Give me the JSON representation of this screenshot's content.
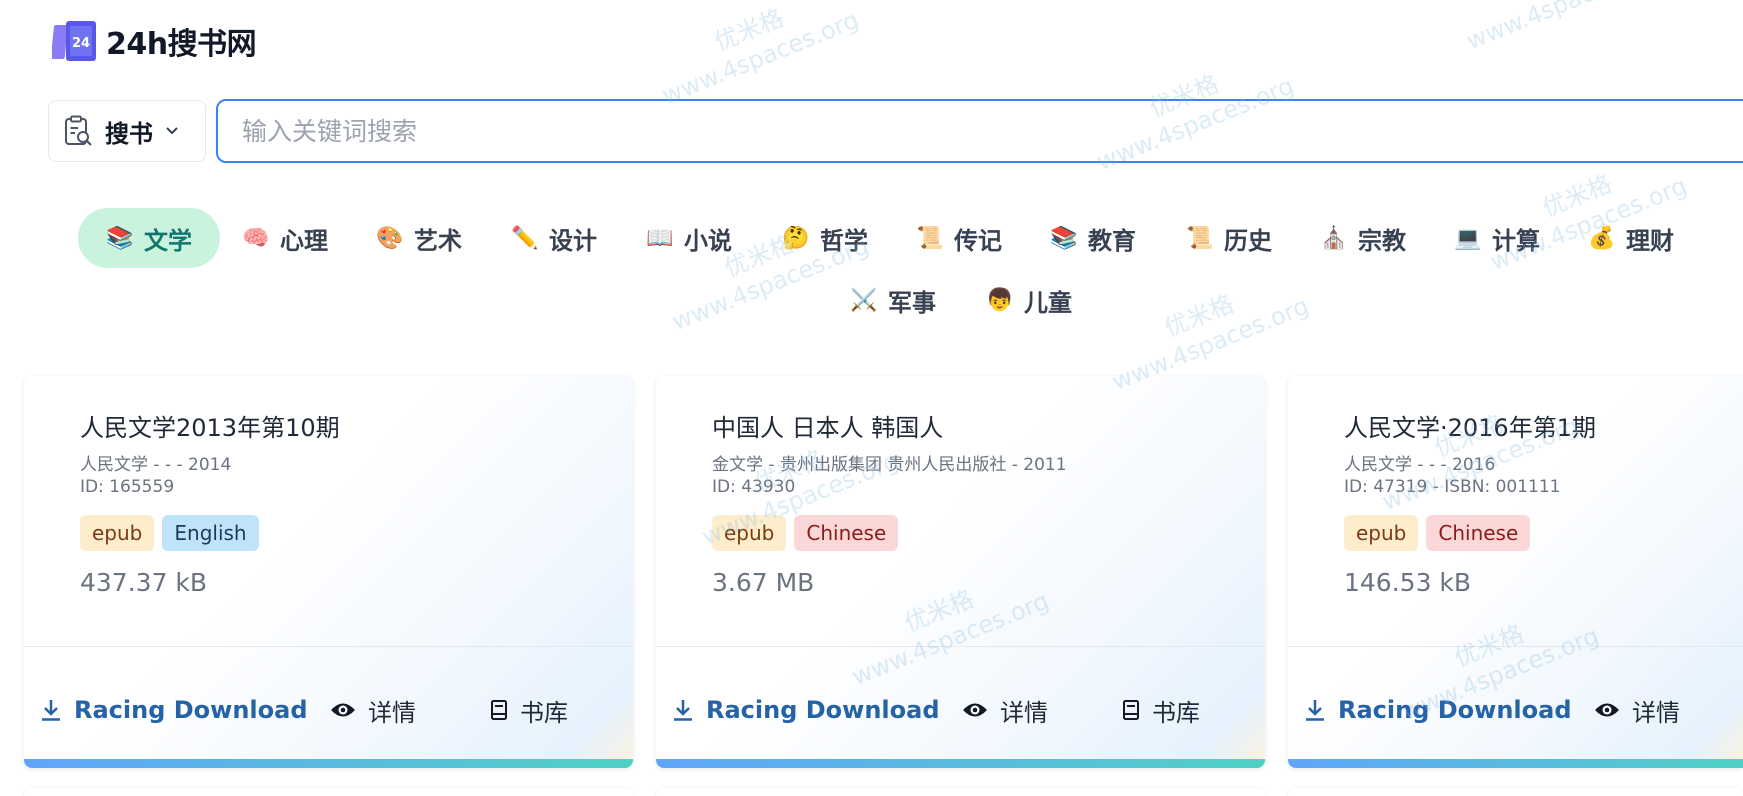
{
  "site": {
    "name": "24h搜书网",
    "logo_text": "24"
  },
  "search": {
    "type_label": "搜书",
    "placeholder": "输入关键词搜索"
  },
  "categories": [
    {
      "emoji": "📚",
      "label": "文学",
      "active": true
    },
    {
      "emoji": "🧠",
      "label": "心理"
    },
    {
      "emoji": "🎨",
      "label": "艺术"
    },
    {
      "emoji": "✏️",
      "label": "设计"
    },
    {
      "emoji": "📖",
      "label": "小说"
    },
    {
      "emoji": "🤔",
      "label": "哲学"
    },
    {
      "emoji": "📜",
      "label": "传记"
    },
    {
      "emoji": "📚",
      "label": "教育"
    },
    {
      "emoji": "📜",
      "label": "历史"
    },
    {
      "emoji": "⛪",
      "label": "宗教"
    },
    {
      "emoji": "💻",
      "label": "计算"
    },
    {
      "emoji": "💰",
      "label": "理财"
    },
    {
      "emoji": "⚔️",
      "label": "军事"
    },
    {
      "emoji": "👦",
      "label": "儿童"
    }
  ],
  "books": [
    {
      "title": "人民文学2013年第10期",
      "meta": "人民文学 - - - 2014",
      "id_line": "ID: 165559",
      "format": "epub",
      "language": "English",
      "size": "437.37 kB"
    },
    {
      "title": "中国人 日本人 韩国人",
      "meta": "金文学 - 贵州出版集团 贵州人民出版社 - 2011",
      "id_line": "ID: 43930",
      "format": "epub",
      "language": "Chinese",
      "size": "3.67 MB"
    },
    {
      "title": "人民文学·2016年第1期",
      "meta": "人民文学 - - - 2016",
      "id_line": "ID: 47319 - ISBN: 001111",
      "format": "epub",
      "language": "Chinese",
      "size": "146.53 kB"
    }
  ],
  "actions": {
    "download": "Racing Download",
    "detail": "详情",
    "library": "书库"
  },
  "watermark": {
    "line1": "优米格",
    "line2": "www.4spaces.org"
  },
  "colors": {
    "accent": "#3b82f6",
    "active_category_bg": "#c9f3dc",
    "download_text": "#2563a8"
  }
}
